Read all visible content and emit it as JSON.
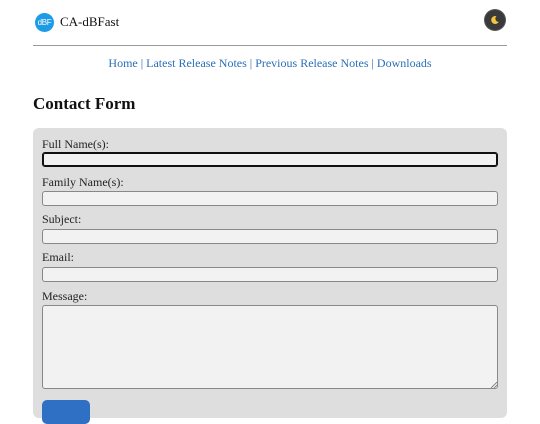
{
  "header": {
    "logo_text": "dBF",
    "app_title": "CA-dBFast",
    "theme_toggle_icon": "moon-icon"
  },
  "nav": {
    "items": [
      {
        "label": "Home"
      },
      {
        "label": "Latest Release Notes"
      },
      {
        "label": "Previous Release Notes"
      },
      {
        "label": "Downloads"
      }
    ],
    "separator": " | "
  },
  "page": {
    "title": "Contact Form"
  },
  "form": {
    "fields": [
      {
        "label": "Full Name(s):",
        "value": "",
        "focused": true
      },
      {
        "label": "Family Name(s):",
        "value": ""
      },
      {
        "label": "Subject:",
        "value": ""
      },
      {
        "label": "Email:",
        "value": ""
      },
      {
        "label": "Message:",
        "value": ""
      }
    ],
    "submit_label": ""
  },
  "colors": {
    "accent": "#2f6fc4",
    "link": "#2a6fb8",
    "card_bg": "#dedede"
  }
}
